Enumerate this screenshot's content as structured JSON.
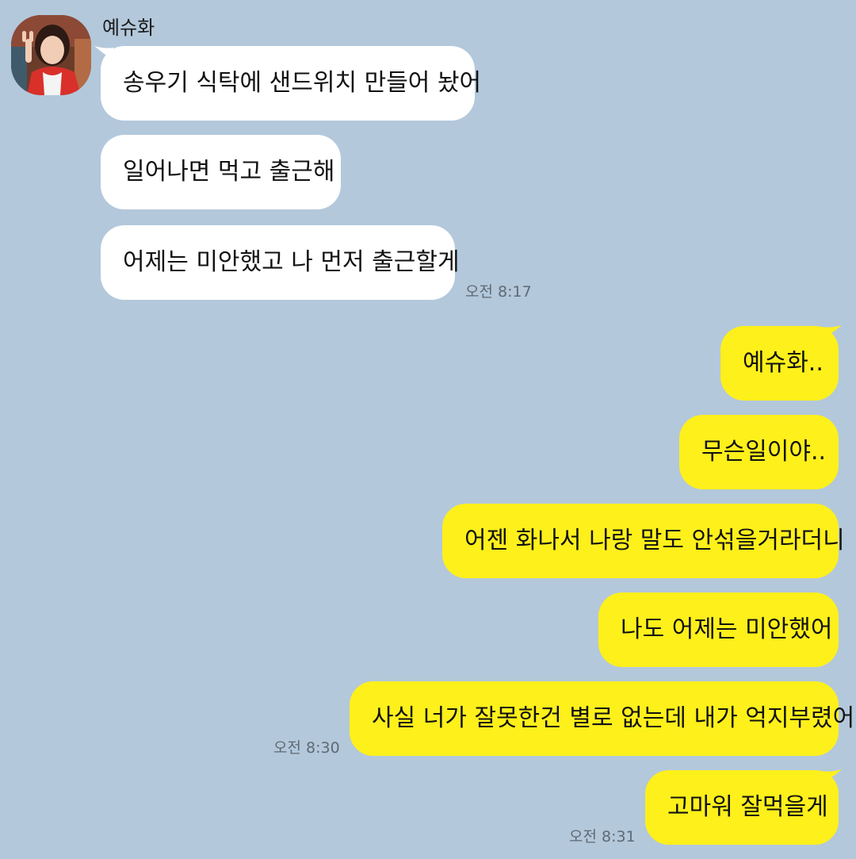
{
  "chat": {
    "partner_name": "예슈화",
    "colors": {
      "background": "#b3c8db",
      "incoming_bubble": "#ffffff",
      "outgoing_bubble": "#fef01b",
      "timestamp": "#5f6a74"
    },
    "incoming": [
      {
        "text": "송우기 식탁에 샌드위치 만들어 놨어"
      },
      {
        "text": "일어나면 먹고 출근해"
      },
      {
        "text": "어제는 미안했고 나 먼저 출근할게"
      }
    ],
    "incoming_time": "오전 8:17",
    "outgoing": [
      {
        "text": "예슈화.."
      },
      {
        "text": "무슨일이야.."
      },
      {
        "text": "어젠 화나서 나랑 말도 안섞을거라더니"
      },
      {
        "text": "나도 어제는 미안했어"
      },
      {
        "text": "사실 너가 잘못한건 별로 없는데 내가 억지부렸어"
      },
      {
        "text": "고마워 잘먹을게"
      }
    ],
    "outgoing_time_1": "오전 8:30",
    "outgoing_time_2": "오전 8:31",
    "icons": {
      "avatar": "profile-photo"
    }
  }
}
